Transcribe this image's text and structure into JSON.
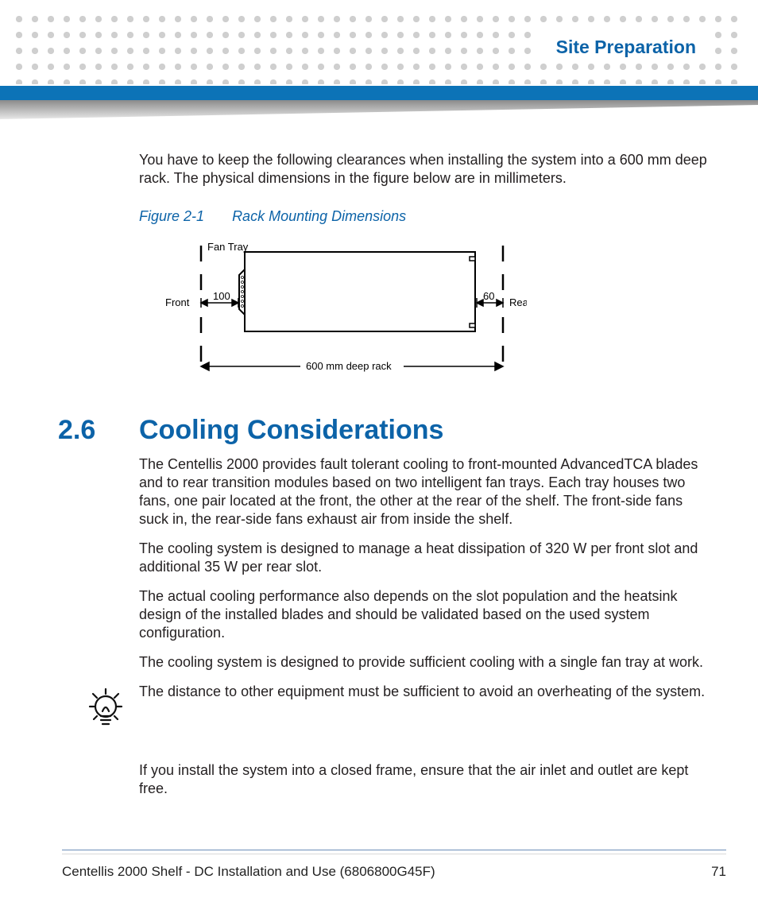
{
  "header": {
    "chapter_title": "Site Preparation"
  },
  "intro_paragraph": "You have to keep the following clearances when installing the system into a 600 mm deep rack. The physical dimensions in the figure below are in millimeters.",
  "figure": {
    "number": "Figure 2-1",
    "title": "Rack Mounting Dimensions",
    "labels": {
      "fan_tray": "Fan Tray",
      "front": "Front",
      "rear": "Rear",
      "front_dim": "100",
      "rear_dim": "60",
      "caption": "600 mm deep rack"
    }
  },
  "section": {
    "number": "2.6",
    "title": "Cooling Considerations",
    "paragraphs": [
      "The Centellis 2000 provides fault tolerant cooling to front-mounted AdvancedTCA blades and to rear transition modules based on two intelligent fan trays. Each tray houses two fans, one pair located at the front, the other at the rear of the shelf. The front-side fans suck in, the rear-side fans exhaust air from inside the shelf.",
      "The cooling system is designed to manage a heat dissipation of 320 W per front slot and additional 35 W per rear slot.",
      "The actual cooling performance also depends on the slot population and the heatsink design of the installed blades and should be validated based on the used system configuration.",
      "The cooling system is designed to provide sufficient cooling with a single fan tray at work."
    ],
    "tip": "The distance to other equipment must be sufficient to avoid an overheating of the system.",
    "after_tip": "If you install the system into a closed frame, ensure that the air inlet and outlet are kept free."
  },
  "footer": {
    "doc_title": "Centellis 2000 Shelf - DC Installation and Use (6806800G45F)",
    "page_number": "71"
  }
}
